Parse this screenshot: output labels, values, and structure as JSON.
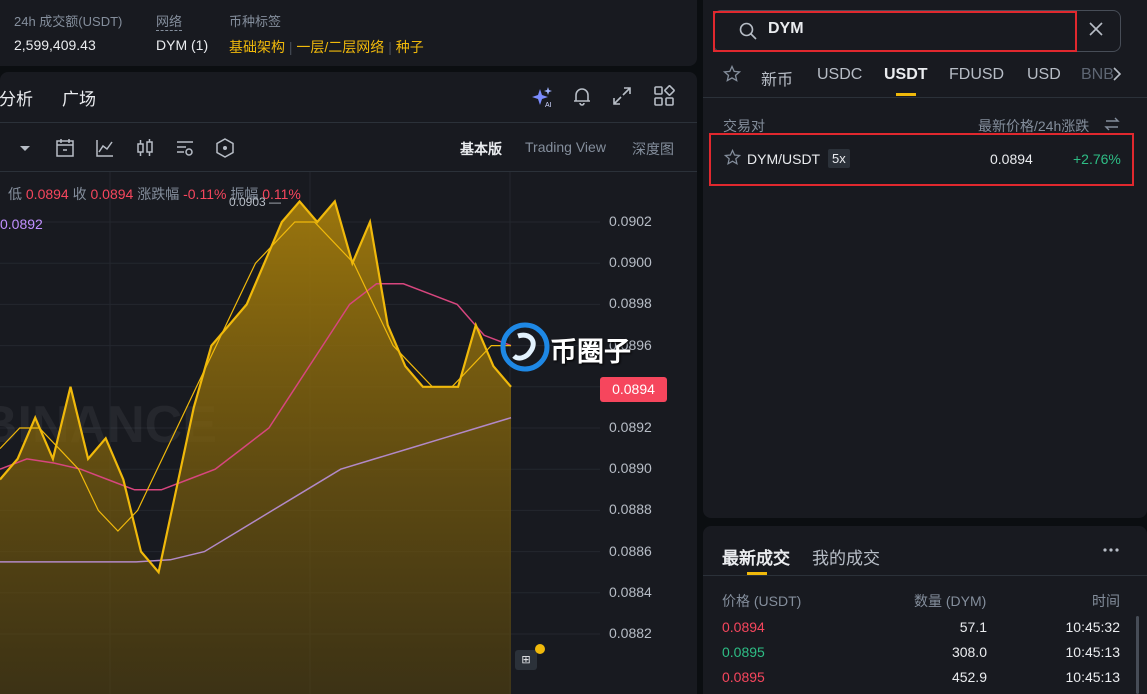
{
  "stats": {
    "volume_label": "24h 成交额(USDT)",
    "volume_value": "2,599,409.43",
    "network_label": "网络",
    "network_value": "DYM (1)",
    "tags_label": "币种标签",
    "tags": [
      "基础架构",
      "一层/二层网络",
      "种子"
    ],
    "tag_sep": "|"
  },
  "chart_panel": {
    "tabs": [
      "分析",
      "广场"
    ],
    "versions": [
      "基本版",
      "Trading View",
      "深度图"
    ],
    "ohlc": {
      "low_label": "低",
      "low_value": "0.0894",
      "close_label": "收",
      "close_value": "0.0894",
      "change_label": "涨跌幅",
      "change_value": "-0.11%",
      "amplitude_label": "振幅",
      "amplitude_value": "0.11%"
    },
    "ma_value": "0.0892",
    "high_marker": "0.0903 —",
    "watermark": "BINANCE",
    "logo_text": "币圈子",
    "current_price_tag": "0.0894",
    "y_ticks": [
      "0.0902",
      "0.0900",
      "0.0898",
      "0.0896",
      "0.0894",
      "0.0892",
      "0.0890",
      "0.0888",
      "0.0886",
      "0.0884",
      "0.0882"
    ]
  },
  "chart_data": {
    "type": "area",
    "y_range": [
      0.0881,
      0.0903
    ],
    "series": [
      {
        "values": [
          0.08895,
          0.08905,
          0.08925,
          0.08905,
          0.0894,
          0.08905,
          0.08915,
          0.08895,
          0.0886,
          0.0885,
          0.0889,
          0.0893,
          0.0896,
          0.0897,
          0.0898,
          0.09,
          0.0902,
          0.0903,
          0.0902,
          0.0903,
          0.09,
          0.0902,
          0.0897,
          0.0895,
          0.0894,
          0.0894,
          0.0894,
          0.0897,
          0.0895,
          0.0894
        ],
        "color": "#f0b90b"
      },
      {
        "values": [
          0.0891,
          0.0892,
          0.0892,
          0.0891,
          0.089,
          0.0888,
          0.0887,
          0.0888,
          0.089,
          0.0892,
          0.0894,
          0.0896,
          0.0898,
          0.09,
          0.0901,
          0.0902,
          0.0902,
          0.0901,
          0.09,
          0.0898,
          0.0896,
          0.0895,
          0.0894,
          0.0894,
          0.0895,
          0.0896,
          0.0896
        ],
        "color": "#f0b90b"
      },
      {
        "values": [
          0.089,
          0.08905,
          0.08903,
          0.089,
          0.08895,
          0.0889,
          0.0889,
          0.08895,
          0.089,
          0.0891,
          0.0892,
          0.0894,
          0.0896,
          0.0898,
          0.0899,
          0.0899,
          0.08985,
          0.0898,
          0.08965,
          0.0896
        ],
        "color": "#d7467e"
      },
      {
        "values": [
          0.08855,
          0.08855,
          0.08855,
          0.08855,
          0.08855,
          0.08856,
          0.0886,
          0.0887,
          0.0888,
          0.0889,
          0.089,
          0.08905,
          0.0891,
          0.08915,
          0.0892,
          0.08925
        ],
        "color": "#b289c7"
      }
    ]
  },
  "search": {
    "query": "DYM",
    "tabs": [
      "新币",
      "USDC",
      "USDT",
      "FDUSD",
      "USD",
      "BNB"
    ],
    "active_tab": "USDT",
    "header_pair": "交易对",
    "header_price": "最新价格/24h涨跌",
    "pairs": [
      {
        "name": "DYM/USDT",
        "leverage": "5x",
        "price": "0.0894",
        "change": "+2.76%"
      }
    ]
  },
  "trades": {
    "tabs": [
      "最新成交",
      "我的成交"
    ],
    "headers": {
      "price": "价格 (USDT)",
      "amount": "数量 (DYM)",
      "time": "时间"
    },
    "rows": [
      {
        "price": "0.0894",
        "amount": "57.1",
        "time": "10:45:32",
        "side": "sell"
      },
      {
        "price": "0.0895",
        "amount": "308.0",
        "time": "10:45:13",
        "side": "buy"
      },
      {
        "price": "0.0895",
        "amount": "452.9",
        "time": "10:45:13",
        "side": "sell"
      }
    ]
  },
  "colors": {
    "up": "#2ebd85",
    "down": "#f6465d",
    "accent": "#f0b90b",
    "highlight": "#e0282e"
  }
}
